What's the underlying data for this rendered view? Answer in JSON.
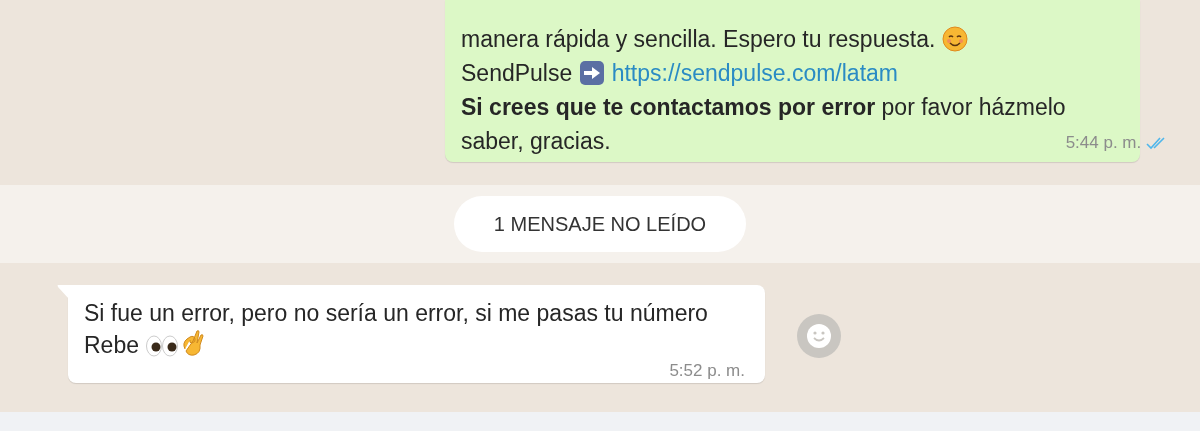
{
  "messages": [
    {
      "kind": "outgoing",
      "read": true,
      "time": "5:44 p. m.",
      "parts": [
        {
          "kind": "text",
          "text": "manera rápida y sencilla. Espero tu respuesta. "
        },
        {
          "kind": "smiley"
        },
        {
          "kind": "break"
        },
        {
          "kind": "text",
          "text": "SendPulse "
        },
        {
          "kind": "arrow"
        },
        {
          "kind": "link",
          "text": "https://sendpulse.com/latam"
        },
        {
          "kind": "break"
        },
        {
          "kind": "text",
          "text": "**Si crees que te contactamos por error** por favor házmelo"
        },
        {
          "kind": "break"
        },
        {
          "kind": "text",
          "text": "saber, gracias."
        }
      ]
    },
    {
      "kind": "unread_divider",
      "text": "1 MENSAJE NO LEÍDO"
    },
    {
      "kind": "incoming",
      "time": "5:52 p. m.",
      "parts": [
        {
          "kind": "text",
          "text": "Si fue un error, pero no sería un error, si me pasas tu número"
        },
        {
          "kind": "break"
        },
        {
          "kind": "text",
          "text": "Rebe "
        },
        {
          "kind": "eyes"
        },
        {
          "kind": "ok_hand"
        }
      ]
    }
  ]
}
